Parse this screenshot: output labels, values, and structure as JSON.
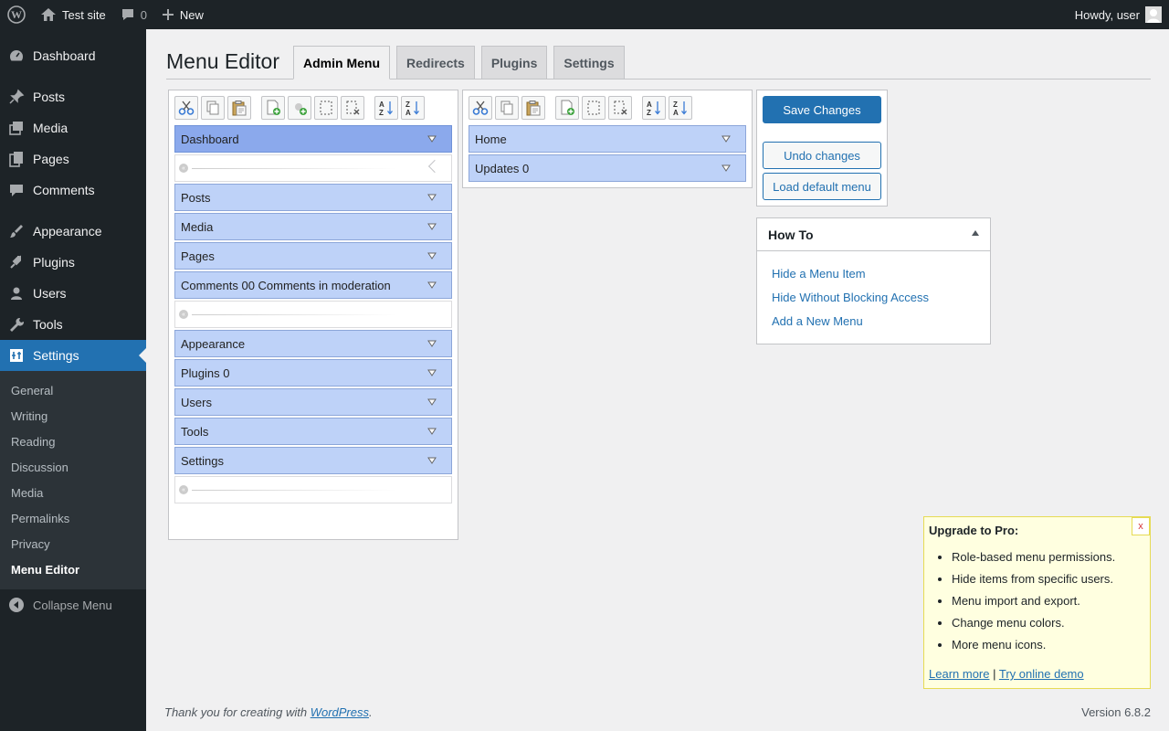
{
  "adminbar": {
    "site_name": "Test site",
    "comments_count": "0",
    "new_label": "New",
    "howdy": "Howdy, user"
  },
  "sidebar": {
    "items": [
      {
        "label": "Dashboard",
        "icon": "dashboard-icon"
      },
      {
        "label": "Posts",
        "icon": "pin-icon"
      },
      {
        "label": "Media",
        "icon": "media-icon"
      },
      {
        "label": "Pages",
        "icon": "pages-icon"
      },
      {
        "label": "Comments",
        "icon": "comments-icon"
      },
      {
        "label": "Appearance",
        "icon": "appearance-icon"
      },
      {
        "label": "Plugins",
        "icon": "plugins-icon"
      },
      {
        "label": "Users",
        "icon": "users-icon"
      },
      {
        "label": "Tools",
        "icon": "tools-icon"
      },
      {
        "label": "Settings",
        "icon": "settings-icon"
      }
    ],
    "submenu": [
      "General",
      "Writing",
      "Reading",
      "Discussion",
      "Media",
      "Permalinks",
      "Privacy",
      "Menu Editor"
    ],
    "collapse_label": "Collapse Menu"
  },
  "page": {
    "title": "Menu Editor",
    "tabs": [
      "Admin Menu",
      "Redirects",
      "Plugins",
      "Settings"
    ]
  },
  "left_menu": [
    {
      "type": "item",
      "label": "Dashboard"
    },
    {
      "type": "separator"
    },
    {
      "type": "item",
      "label": "Posts"
    },
    {
      "type": "item",
      "label": "Media"
    },
    {
      "type": "item",
      "label": "Pages"
    },
    {
      "type": "item",
      "label": "Comments 00 Comments in moderation"
    },
    {
      "type": "separator"
    },
    {
      "type": "item",
      "label": "Appearance"
    },
    {
      "type": "item",
      "label": "Plugins 0"
    },
    {
      "type": "item",
      "label": "Users"
    },
    {
      "type": "item",
      "label": "Tools"
    },
    {
      "type": "item",
      "label": "Settings"
    },
    {
      "type": "separator"
    }
  ],
  "right_menu": [
    "Home",
    "Updates 0"
  ],
  "buttons": {
    "save": "Save Changes",
    "undo": "Undo changes",
    "load_default": "Load default menu"
  },
  "howto": {
    "title": "How To",
    "links": [
      "Hide a Menu Item",
      "Hide Without Blocking Access",
      "Add a New Menu"
    ]
  },
  "upgrade": {
    "title": "Upgrade to Pro:",
    "close": "x",
    "items": [
      "Role-based menu permissions.",
      "Hide items from specific users.",
      "Menu import and export.",
      "Change menu colors.",
      "More menu icons."
    ],
    "learn_more": "Learn more",
    "divider": "|",
    "demo": "Try online demo"
  },
  "footer": {
    "thanks_prefix": "Thank you for creating with ",
    "wordpress": "WordPress",
    "thanks_suffix": ".",
    "version": "Version 6.8.2"
  },
  "colors": {
    "admin_dark": "#1d2327",
    "accent": "#2271b1",
    "menu_item": "#bed2f8",
    "menu_item_selected": "#8ba9ec"
  }
}
